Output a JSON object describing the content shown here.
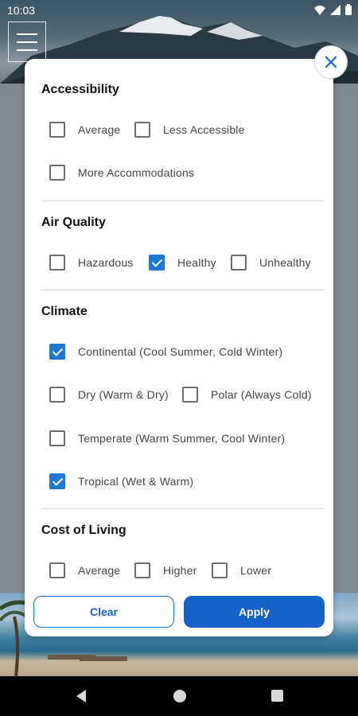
{
  "status_bar": {
    "time": "10:03"
  },
  "sections": [
    {
      "title": "Accessibility",
      "options": [
        {
          "label": "Average",
          "checked": false
        },
        {
          "label": "Less Accessible",
          "checked": false
        },
        {
          "label": "More Accommodations",
          "checked": false
        }
      ]
    },
    {
      "title": "Air Quality",
      "options": [
        {
          "label": "Hazardous",
          "checked": false
        },
        {
          "label": "Healthy",
          "checked": true
        },
        {
          "label": "Unhealthy",
          "checked": false
        }
      ]
    },
    {
      "title": "Climate",
      "options": [
        {
          "label": "Continental (Cool Summer, Cold Winter)",
          "checked": true
        },
        {
          "label": "Dry (Warm & Dry)",
          "checked": false
        },
        {
          "label": "Polar (Always Cold)",
          "checked": false
        },
        {
          "label": "Temperate (Warm Summer, Cool Winter)",
          "checked": false
        },
        {
          "label": "Tropical (Wet & Warm)",
          "checked": true
        }
      ]
    },
    {
      "title": "Cost of Living",
      "options": [
        {
          "label": "Average",
          "checked": false
        },
        {
          "label": "Higher",
          "checked": false
        },
        {
          "label": "Lower",
          "checked": false
        }
      ]
    }
  ],
  "footer": {
    "clear_label": "Clear",
    "apply_label": "Apply"
  },
  "colors": {
    "accent": "#1762c9",
    "checked": "#1f78d1"
  },
  "icons": {
    "close": "close-icon",
    "menu": "hamburger-menu-icon"
  }
}
